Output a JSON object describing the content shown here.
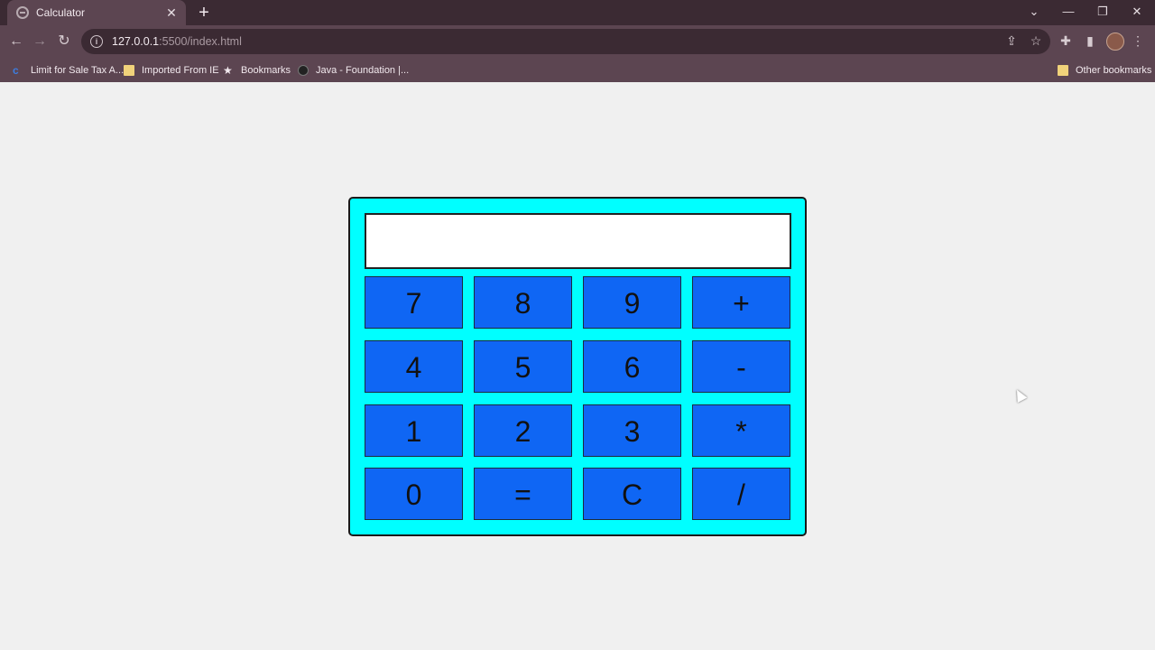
{
  "tab": {
    "title": "Calculator",
    "close": "✕"
  },
  "toolbar": {
    "url_host": "127.0.0.1",
    "url_path": ":5500/index.html"
  },
  "bookmarks": {
    "items": [
      {
        "label": "Limit for Sale Tax A...",
        "icon": "c-icon"
      },
      {
        "label": "Imported From IE",
        "icon": "folder-icon"
      },
      {
        "label": "Bookmarks",
        "icon": "star-icon"
      },
      {
        "label": "Java - Foundation |...",
        "icon": "globe-icon"
      }
    ],
    "other": "Other bookmarks"
  },
  "calculator": {
    "display_value": "",
    "keys": [
      [
        "7",
        "8",
        "9",
        "+"
      ],
      [
        "4",
        "5",
        "6",
        "-"
      ],
      [
        "1",
        "2",
        "3",
        "*"
      ],
      [
        "0",
        "=",
        "C",
        "/"
      ]
    ]
  },
  "colors": {
    "calculator_bg": "#00ffff",
    "key_bg": "#0f66f4",
    "page_bg": "#f0f0f0",
    "chrome_bg": "#5c4551",
    "tabbar_bg": "#3b2a33"
  }
}
